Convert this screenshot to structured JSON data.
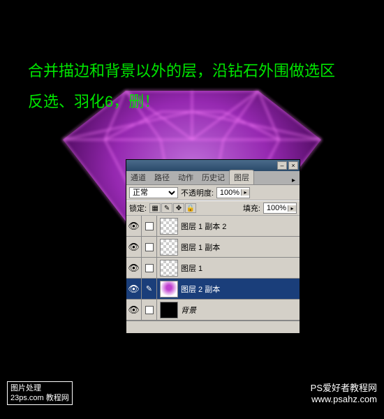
{
  "instruction": {
    "line1": "合并描边和背景以外的层，沿钻石外围做选区",
    "line2": "反选、羽化6，删！"
  },
  "panel": {
    "tabs": [
      "通道",
      "路径",
      "动作",
      "历史记",
      "图层"
    ],
    "activeTab": 4,
    "blendMode": "正常",
    "opacityLabel": "不透明度:",
    "opacityValue": "100%",
    "lockLabel": "锁定:",
    "fillLabel": "填充:",
    "fillValue": "100%",
    "layers": [
      {
        "name": "图层 1 副本 2",
        "thumb": "trans",
        "selected": false,
        "link": "chk"
      },
      {
        "name": "图层 1 副本",
        "thumb": "trans",
        "selected": false,
        "link": "chk"
      },
      {
        "name": "图层 1",
        "thumb": "trans",
        "selected": false,
        "link": "chk"
      },
      {
        "name": "图层 2 副本",
        "thumb": "diamond-t",
        "selected": true,
        "link": "brush"
      },
      {
        "name": "背景",
        "thumb": "black",
        "selected": false,
        "link": "chk",
        "italic": true
      }
    ]
  },
  "watermark1": {
    "line1": "图片处理",
    "line2": "23ps.com 教程网"
  },
  "watermark2": {
    "line1": "PS爱好者教程网",
    "line2": "www.psahz.com"
  }
}
